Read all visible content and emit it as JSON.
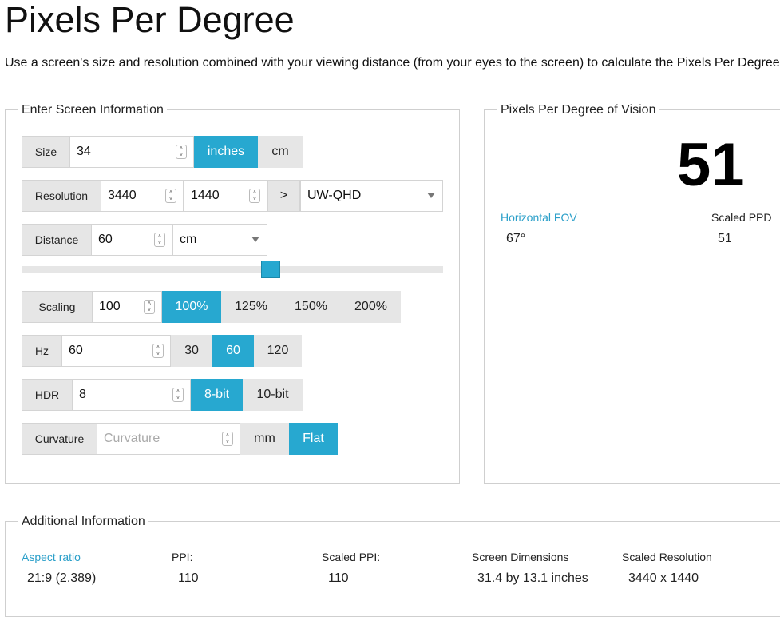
{
  "page": {
    "title": "Pixels Per Degree",
    "intro": "Use a screen's size and resolution combined with your viewing distance (from your eyes to the screen) to calculate the Pixels Per Degree"
  },
  "input_panel": {
    "legend": "Enter Screen Information",
    "size": {
      "label": "Size",
      "value": "34",
      "unit_options": [
        "inches",
        "cm"
      ],
      "selected_unit": "inches"
    },
    "resolution": {
      "label": "Resolution",
      "width": "3440",
      "height": "1440",
      "arrow": ">",
      "preset": "UW-QHD"
    },
    "distance": {
      "label": "Distance",
      "value": "60",
      "unit": "cm",
      "slider_fraction": 0.59
    },
    "scaling": {
      "label": "Scaling",
      "value": "100",
      "options": [
        "100%",
        "125%",
        "150%",
        "200%"
      ],
      "selected": "100%"
    },
    "hz": {
      "label": "Hz",
      "value": "60",
      "options": [
        "30",
        "60",
        "120"
      ],
      "selected": "60"
    },
    "hdr": {
      "label": "HDR",
      "value": "8",
      "options": [
        "8-bit",
        "10-bit"
      ],
      "selected": "8-bit"
    },
    "curvature": {
      "label": "Curvature",
      "placeholder": "Curvature",
      "unit": "mm",
      "flat_label": "Flat",
      "flat_selected": true
    }
  },
  "result_panel": {
    "legend": "Pixels Per Degree of Vision",
    "ppd": "51",
    "horizontal_fov_label": "Horizontal FOV",
    "horizontal_fov_value": "67°",
    "scaled_ppd_label": "Scaled PPD",
    "scaled_ppd_value": "51"
  },
  "additional_panel": {
    "legend": "Additional Information",
    "aspect_ratio_label": "Aspect ratio",
    "aspect_ratio_value": "21:9 (2.389)",
    "ppi_label": "PPI:",
    "ppi_value": "110",
    "scaled_ppi_label": "Scaled PPI:",
    "scaled_ppi_value": "110",
    "screen_dimensions_label": "Screen Dimensions",
    "screen_dimensions_value": "31.4 by 13.1 inches",
    "scaled_resolution_label": "Scaled Resolution",
    "scaled_resolution_value": "3440 x 1440"
  },
  "colors": {
    "accent": "#27a8d0",
    "label_bg": "#e6e6e6",
    "info_label": "#2a9fc9"
  }
}
